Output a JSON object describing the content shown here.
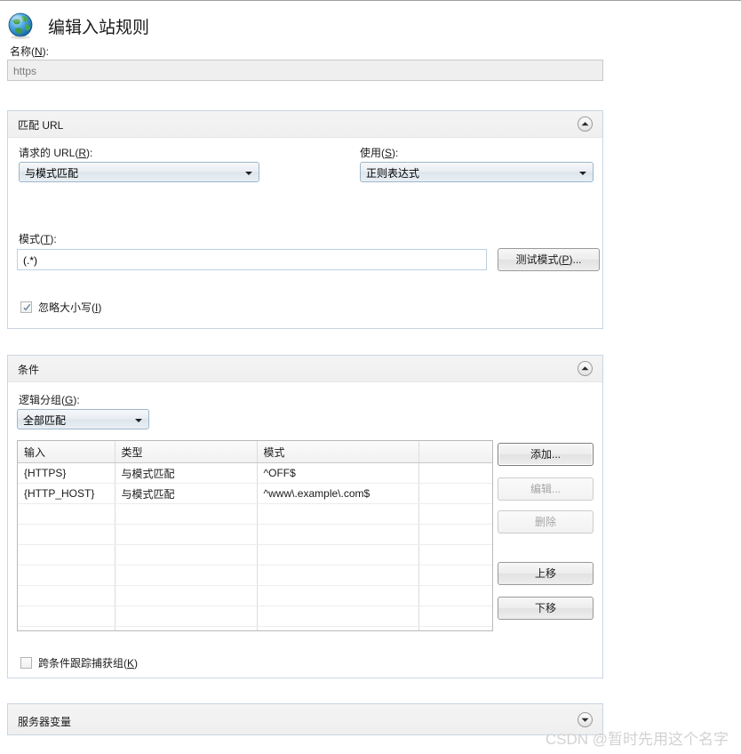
{
  "window": {
    "title": "编辑入站规则",
    "icon": "globe-icon"
  },
  "name_field": {
    "label": "名称(N):",
    "value": "https",
    "disabled": true
  },
  "match_url": {
    "section_title": "匹配 URL",
    "collapse_icon": "chevron-up-icon",
    "requested_url": {
      "label": "请求的 URL(R):",
      "value": "与模式匹配"
    },
    "using": {
      "label": "使用(S):",
      "value": "正则表达式"
    },
    "pattern": {
      "label": "模式(T):",
      "value": "(.*)"
    },
    "test_pattern_button": "测试模式(P)...",
    "ignore_case": {
      "label": "忽略大小写(I)",
      "checked": true
    }
  },
  "conditions": {
    "section_title": "条件",
    "collapse_icon": "chevron-up-icon",
    "logical_grouping": {
      "label": "逻辑分组(G):",
      "value": "全部匹配"
    },
    "table": {
      "columns": [
        "输入",
        "类型",
        "模式",
        ""
      ],
      "rows": [
        [
          "{HTTPS}",
          "与模式匹配",
          "^OFF$",
          ""
        ],
        [
          "{HTTP_HOST}",
          "与模式匹配",
          "^www\\.example\\.com$",
          ""
        ]
      ],
      "empty_row_count": 8
    },
    "buttons": [
      {
        "label": "添加...",
        "state": "focused"
      },
      {
        "label": "编辑...",
        "state": "disabled"
      },
      {
        "label": "删除",
        "state": "disabled"
      },
      {
        "label": "上移",
        "state": "normal"
      },
      {
        "label": "下移",
        "state": "normal"
      }
    ],
    "track_capture_groups": {
      "label": "跨条件跟踪捕获组(K)",
      "checked": false
    }
  },
  "server_variables": {
    "section_title": "服务器变量",
    "expand_icon": "chevron-down-icon",
    "collapsed": true
  },
  "watermark": {
    "text": "CSDN @暂时先用这个名字"
  },
  "colors": {
    "panel_border": "#c9d6e3",
    "panel_header": "#f0f0f0",
    "dropdown_border": "#9eb6c9",
    "disabled_text": "#a6a6a6",
    "watermark": "#d2d2d2"
  }
}
